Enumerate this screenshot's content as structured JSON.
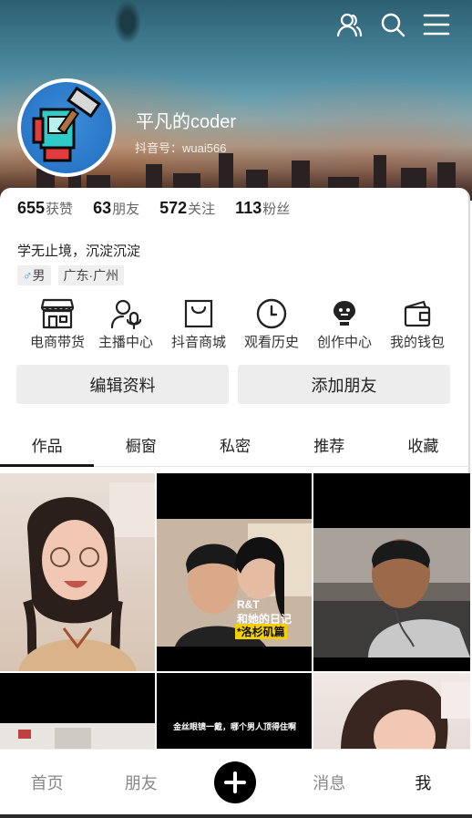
{
  "profile": {
    "nickname": "平凡的coder",
    "douyin_id": "抖音号：wuai566",
    "bio": "学无止境，沉淀沉淀",
    "gender_symbol": "♂",
    "gender": "男",
    "location": "广东·广州"
  },
  "stats": [
    {
      "num": "655",
      "label": "获赞"
    },
    {
      "num": "63",
      "label": "朋友"
    },
    {
      "num": "572",
      "label": "关注"
    },
    {
      "num": "113",
      "label": "粉丝"
    }
  ],
  "services": [
    {
      "label": "电商带货",
      "icon": "store-icon"
    },
    {
      "label": "主播中心",
      "icon": "streamer-icon"
    },
    {
      "label": "抖音商城",
      "icon": "shopping-bag-icon"
    },
    {
      "label": "观看历史",
      "icon": "clock-icon"
    },
    {
      "label": "创作中心",
      "icon": "lightbulb-icon"
    },
    {
      "label": "我的钱包",
      "icon": "wallet-icon"
    }
  ],
  "buttons": {
    "edit": "编辑资料",
    "add_friend": "添加朋友"
  },
  "tabs": [
    "作品",
    "橱窗",
    "私密",
    "推荐",
    "收藏"
  ],
  "grid": {
    "video2_title_top": "R&T",
    "video2_title_mid": "和她的日记",
    "video2_title_bottom": "*洛杉矶篇",
    "video5_caption": "金丝眼镜一戴，哪个男人顶得住啊"
  },
  "nav": {
    "home": "首页",
    "friends": "朋友",
    "messages": "消息",
    "me": "我"
  },
  "colors": {
    "accent_male": "#3b8fdc",
    "text_primary": "#161616",
    "button_bg": "#ededed"
  },
  "icons": {
    "top": [
      "friends-icon",
      "search-icon",
      "menu-icon"
    ]
  }
}
